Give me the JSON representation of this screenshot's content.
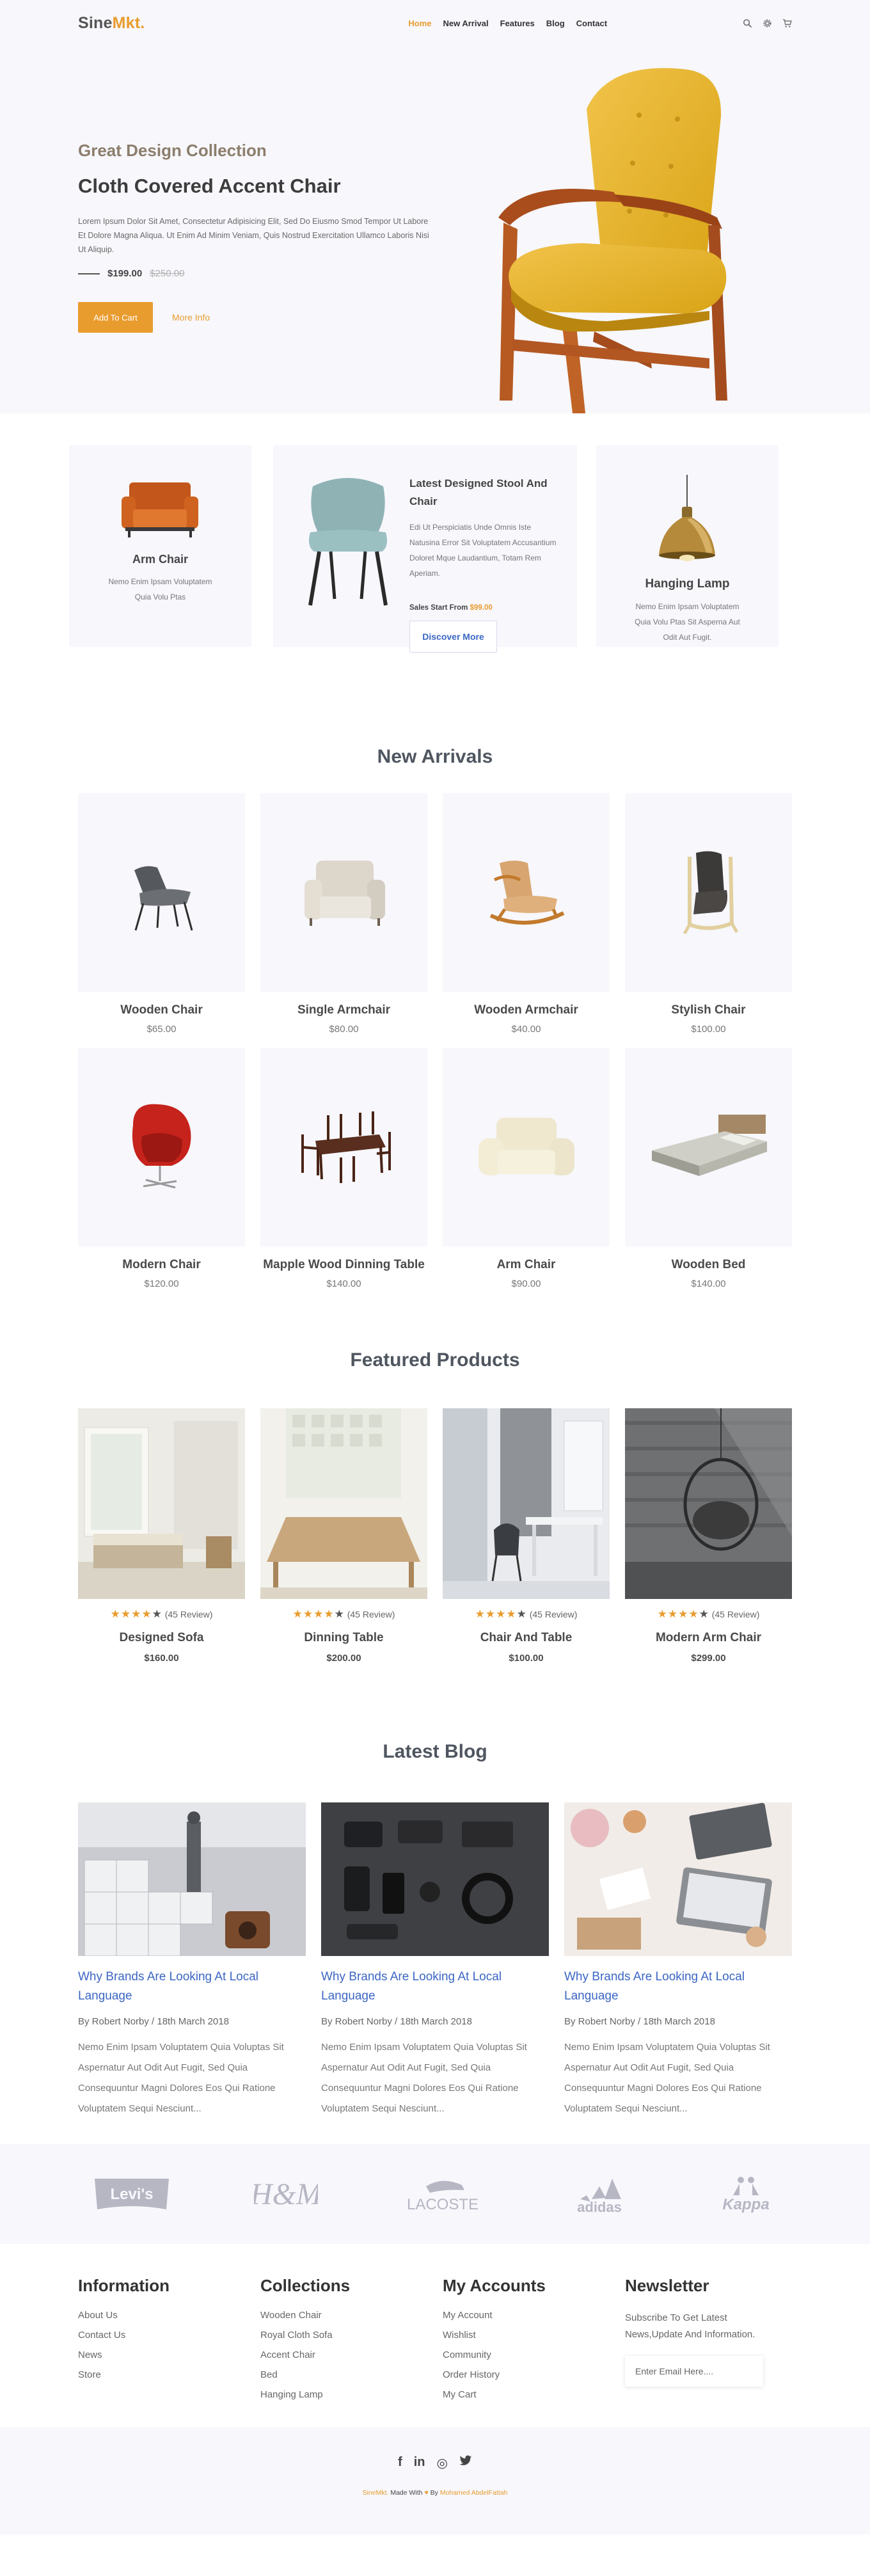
{
  "header": {
    "logo_main": "Sine",
    "logo_accent": "Mkt.",
    "nav": [
      "Home",
      "New Arrival",
      "Features",
      "Blog",
      "Contact"
    ],
    "icons": [
      "search-icon",
      "gear-icon",
      "cart-icon"
    ]
  },
  "hero": {
    "subtitle": "Great Design Collection",
    "title": "Cloth Covered Accent Chair",
    "description": "Lorem Ipsum Dolor Sit Amet, Consectetur Adipisicing Elit, Sed Do Eiusmo Smod Tempor Ut Labore Et Dolore Magna Aliqua. Ut Enim Ad Minim Veniam, Quis Nostrud Exercitation Ullamco Laboris Nisi Ut Aliquip.",
    "price_new": "$199.00",
    "price_old": "$250.00",
    "add_button": "Add To Cart",
    "more_link": "More Info"
  },
  "intro": {
    "card1_title": "Arm Chair",
    "card1_text": "Nemo Enim Ipsam Voluptatem Quia Volu Ptas",
    "card2_title": "Latest Designed Stool And Chair",
    "card2_text": "Edi Ut Perspiciatis Unde Omnis Iste Natusina Error Sit Voluptatem Accusantium Doloret Mque Laudantium, Totam Rem Aperiam.",
    "card2_sales_label": "Sales Start From",
    "card2_sales_price": "$99.00",
    "card2_button": "Discover More",
    "card3_title": "Hanging Lamp",
    "card3_text": "Nemo Enim Ipsam Voluptatem Quia Volu Ptas Sit Asperna Aut Odit Aut Fugit."
  },
  "arrivals": {
    "title": "New Arrivals",
    "items": [
      {
        "name": "Wooden Chair",
        "price": "$65.00"
      },
      {
        "name": "Single Armchair",
        "price": "$80.00"
      },
      {
        "name": "Wooden Armchair",
        "price": "$40.00"
      },
      {
        "name": "Stylish Chair",
        "price": "$100.00"
      },
      {
        "name": "Modern Chair",
        "price": "$120.00"
      },
      {
        "name": "Mapple Wood Dinning Table",
        "price": "$140.00"
      },
      {
        "name": "Arm Chair",
        "price": "$90.00"
      },
      {
        "name": "Wooden Bed",
        "price": "$140.00"
      }
    ]
  },
  "featured": {
    "title": "Featured Products",
    "review_text": "(45 Review)",
    "rating": 4,
    "items": [
      {
        "name": "Designed Sofa",
        "price": "$160.00"
      },
      {
        "name": "Dinning Table",
        "price": "$200.00"
      },
      {
        "name": "Chair And Table",
        "price": "$100.00"
      },
      {
        "name": "Modern Arm Chair",
        "price": "$299.00"
      }
    ]
  },
  "blog": {
    "title": "Latest Blog",
    "posts": [
      {
        "title": "Why Brands Are Looking At Local Language",
        "meta": "By Robert Norby / 18th March 2018",
        "text": "Nemo Enim Ipsam Voluptatem Quia Voluptas Sit Aspernatur Aut Odit Aut Fugit, Sed Quia Consequuntur Magni Dolores Eos Qui Ratione Voluptatem Sequi Nesciunt..."
      },
      {
        "title": "Why Brands Are Looking At Local Language",
        "meta": "By Robert Norby / 18th March 2018",
        "text": "Nemo Enim Ipsam Voluptatem Quia Voluptas Sit Aspernatur Aut Odit Aut Fugit, Sed Quia Consequuntur Magni Dolores Eos Qui Ratione Voluptatem Sequi Nesciunt..."
      },
      {
        "title": "Why Brands Are Looking At Local Language",
        "meta": "By Robert Norby / 18th March 2018",
        "text": "Nemo Enim Ipsam Voluptatem Quia Voluptas Sit Aspernatur Aut Odit Aut Fugit, Sed Quia Consequuntur Magni Dolores Eos Qui Ratione Voluptatem Sequi Nesciunt..."
      }
    ]
  },
  "brands": [
    "Levi's",
    "H&M",
    "LACOSTE",
    "adidas",
    "Kappa"
  ],
  "footer": {
    "information_title": "Information",
    "information_links": [
      "About Us",
      "Contact Us",
      "News",
      "Store"
    ],
    "collections_title": "Collections",
    "collections_links": [
      "Wooden Chair",
      "Royal Cloth Sofa",
      "Accent Chair",
      "Bed",
      "Hanging Lamp"
    ],
    "accounts_title": "My Accounts",
    "accounts_links": [
      "My Account",
      "Wishlist",
      "Community",
      "Order History",
      "My Cart"
    ],
    "newsletter_title": "Newsletter",
    "newsletter_text": "Subscribe To Get Latest News,Update And Information.",
    "email_placeholder": "Enter Email Here....",
    "socials": [
      "f",
      "in",
      "◎",
      "twitter-icon"
    ],
    "credit_brand": "SineMkt.",
    "credit_mid": "Made With",
    "credit_by": "By",
    "credit_author": "Mohamed AbdelFattah"
  },
  "colors": {
    "accent": "#e99c2e",
    "link": "#3b66c4",
    "section_bg": "#f7f7fc"
  }
}
